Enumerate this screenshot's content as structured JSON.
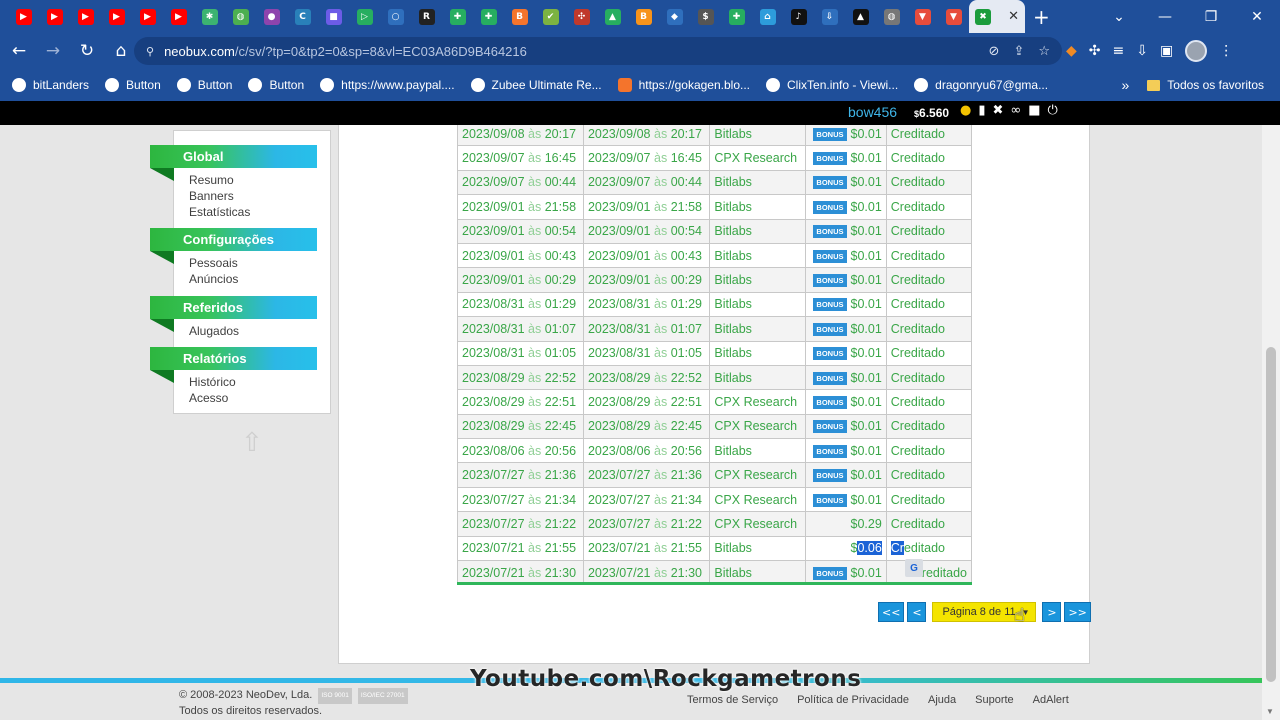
{
  "browser": {
    "tabs": [
      {
        "icon": "youtube-icon",
        "glyph": "▶",
        "color": "#ff0000"
      },
      {
        "icon": "youtube-icon",
        "glyph": "▶",
        "color": "#ff0000"
      },
      {
        "icon": "youtube-icon",
        "glyph": "▶",
        "color": "#ff0000"
      },
      {
        "icon": "youtube-icon",
        "glyph": "▶",
        "color": "#ff0000"
      },
      {
        "icon": "youtube-icon",
        "glyph": "▶",
        "color": "#ff0000"
      },
      {
        "icon": "youtube-icon",
        "glyph": "▶",
        "color": "#ff0000"
      },
      {
        "icon": "pinwheel-icon",
        "glyph": "✱",
        "color": "#3cb371"
      },
      {
        "icon": "globe-icon",
        "glyph": "◍",
        "color": "#4caf50"
      },
      {
        "icon": "pin-icon",
        "glyph": "●",
        "color": "#8e44ad"
      },
      {
        "icon": "circle-c-icon",
        "glyph": "C",
        "color": "#2980b9"
      },
      {
        "icon": "video-icon",
        "glyph": "■",
        "color": "#6c5ce7"
      },
      {
        "icon": "play-icon",
        "glyph": "▷",
        "color": "#27ae60"
      },
      {
        "icon": "circle-icon",
        "glyph": "○",
        "color": "#2f6fbd"
      },
      {
        "icon": "r-icon",
        "glyph": "R",
        "color": "#222222"
      },
      {
        "icon": "leaf-icon",
        "glyph": "✚",
        "color": "#27ae60"
      },
      {
        "icon": "leaf-icon",
        "glyph": "✚",
        "color": "#27ae60"
      },
      {
        "icon": "blogger-icon",
        "glyph": "B",
        "color": "#f4742c"
      },
      {
        "icon": "check-icon",
        "glyph": "✔",
        "color": "#7cb342"
      },
      {
        "icon": "puzzle-icon",
        "glyph": "✣",
        "color": "#c0392b"
      },
      {
        "icon": "triangle-icon",
        "glyph": "▲",
        "color": "#27ae60"
      },
      {
        "icon": "bitcoin-icon",
        "glyph": "B",
        "color": "#f7931a"
      },
      {
        "icon": "ethereum-icon",
        "glyph": "◆",
        "color": "#2f6fbd"
      },
      {
        "icon": "dollar-icon",
        "glyph": "$",
        "color": "#555555"
      },
      {
        "icon": "leaf-icon",
        "glyph": "✚",
        "color": "#27ae60"
      },
      {
        "icon": "home-icon",
        "glyph": "⌂",
        "color": "#2d9cdb"
      },
      {
        "icon": "tiktok-icon",
        "glyph": "♪",
        "color": "#111111"
      },
      {
        "icon": "download-icon",
        "glyph": "⇩",
        "color": "#2f6fbd"
      },
      {
        "icon": "chart-icon",
        "glyph": "▲",
        "color": "#111111"
      },
      {
        "icon": "globe-icon",
        "glyph": "◍",
        "color": "#777777"
      },
      {
        "icon": "shield-icon",
        "glyph": "▼",
        "color": "#e74c3c"
      },
      {
        "icon": "shield-icon",
        "glyph": "▼",
        "color": "#e74c3c"
      }
    ],
    "active_tab_icon": "neobux-icon",
    "url_host": "neobux.com",
    "url_path": "/c/sv/?tp=0&tp2=0&sp=8&vl=EC03A86D9B464216",
    "bookmarks": [
      {
        "label": "bitLanders",
        "icon": "globe-icon"
      },
      {
        "label": "Button",
        "icon": "globe-icon"
      },
      {
        "label": "Button",
        "icon": "globe-icon"
      },
      {
        "label": "Button",
        "icon": "globe-icon"
      },
      {
        "label": "https://www.paypal....",
        "icon": "paypal-icon"
      },
      {
        "label": "Zubee Ultimate Re...",
        "icon": "globe-icon"
      },
      {
        "label": "https://gokagen.blo...",
        "icon": "blogger-icon"
      },
      {
        "label": "ClixTen.info - Viewi...",
        "icon": "globe-icon"
      },
      {
        "label": "dragonryu67@gma...",
        "icon": "google-icon"
      }
    ],
    "all_bookmarks_label": "Todos os favoritos"
  },
  "user": {
    "name": "bow456",
    "balance_symbol": "$",
    "balance": "6.560"
  },
  "sidebar": {
    "sections": [
      {
        "title": "Global",
        "items": [
          "Resumo",
          "Banners",
          "Estatísticas"
        ]
      },
      {
        "title": "Configurações",
        "items": [
          "Pessoais",
          "Anúncios"
        ]
      },
      {
        "title": "Referidos",
        "items": [
          "Alugados"
        ]
      },
      {
        "title": "Relatórios",
        "items": [
          "Histórico",
          "Acesso"
        ]
      }
    ]
  },
  "history": {
    "as_word": "às",
    "bonus_label": "BONUS",
    "rows": [
      {
        "d1": "2023/09/08",
        "t1": "20:17",
        "d2": "2023/09/08",
        "t2": "20:17",
        "source": "Bitlabs",
        "bonus": true,
        "amount": "$0.01",
        "status": "Creditado"
      },
      {
        "d1": "2023/09/07",
        "t1": "16:45",
        "d2": "2023/09/07",
        "t2": "16:45",
        "source": "CPX Research",
        "bonus": true,
        "amount": "$0.01",
        "status": "Creditado"
      },
      {
        "d1": "2023/09/07",
        "t1": "00:44",
        "d2": "2023/09/07",
        "t2": "00:44",
        "source": "Bitlabs",
        "bonus": true,
        "amount": "$0.01",
        "status": "Creditado"
      },
      {
        "d1": "2023/09/01",
        "t1": "21:58",
        "d2": "2023/09/01",
        "t2": "21:58",
        "source": "Bitlabs",
        "bonus": true,
        "amount": "$0.01",
        "status": "Creditado"
      },
      {
        "d1": "2023/09/01",
        "t1": "00:54",
        "d2": "2023/09/01",
        "t2": "00:54",
        "source": "Bitlabs",
        "bonus": true,
        "amount": "$0.01",
        "status": "Creditado"
      },
      {
        "d1": "2023/09/01",
        "t1": "00:43",
        "d2": "2023/09/01",
        "t2": "00:43",
        "source": "Bitlabs",
        "bonus": true,
        "amount": "$0.01",
        "status": "Creditado"
      },
      {
        "d1": "2023/09/01",
        "t1": "00:29",
        "d2": "2023/09/01",
        "t2": "00:29",
        "source": "Bitlabs",
        "bonus": true,
        "amount": "$0.01",
        "status": "Creditado"
      },
      {
        "d1": "2023/08/31",
        "t1": "01:29",
        "d2": "2023/08/31",
        "t2": "01:29",
        "source": "Bitlabs",
        "bonus": true,
        "amount": "$0.01",
        "status": "Creditado"
      },
      {
        "d1": "2023/08/31",
        "t1": "01:07",
        "d2": "2023/08/31",
        "t2": "01:07",
        "source": "Bitlabs",
        "bonus": true,
        "amount": "$0.01",
        "status": "Creditado"
      },
      {
        "d1": "2023/08/31",
        "t1": "01:05",
        "d2": "2023/08/31",
        "t2": "01:05",
        "source": "Bitlabs",
        "bonus": true,
        "amount": "$0.01",
        "status": "Creditado"
      },
      {
        "d1": "2023/08/29",
        "t1": "22:52",
        "d2": "2023/08/29",
        "t2": "22:52",
        "source": "Bitlabs",
        "bonus": true,
        "amount": "$0.01",
        "status": "Creditado"
      },
      {
        "d1": "2023/08/29",
        "t1": "22:51",
        "d2": "2023/08/29",
        "t2": "22:51",
        "source": "CPX Research",
        "bonus": true,
        "amount": "$0.01",
        "status": "Creditado"
      },
      {
        "d1": "2023/08/29",
        "t1": "22:45",
        "d2": "2023/08/29",
        "t2": "22:45",
        "source": "CPX Research",
        "bonus": true,
        "amount": "$0.01",
        "status": "Creditado"
      },
      {
        "d1": "2023/08/06",
        "t1": "20:56",
        "d2": "2023/08/06",
        "t2": "20:56",
        "source": "Bitlabs",
        "bonus": true,
        "amount": "$0.01",
        "status": "Creditado"
      },
      {
        "d1": "2023/07/27",
        "t1": "21:36",
        "d2": "2023/07/27",
        "t2": "21:36",
        "source": "CPX Research",
        "bonus": true,
        "amount": "$0.01",
        "status": "Creditado"
      },
      {
        "d1": "2023/07/27",
        "t1": "21:34",
        "d2": "2023/07/27",
        "t2": "21:34",
        "source": "CPX Research",
        "bonus": true,
        "amount": "$0.01",
        "status": "Creditado"
      },
      {
        "d1": "2023/07/27",
        "t1": "21:22",
        "d2": "2023/07/27",
        "t2": "21:22",
        "source": "CPX Research",
        "bonus": false,
        "amount": "$0.29",
        "status": "Creditado"
      },
      {
        "d1": "2023/07/21",
        "t1": "21:55",
        "d2": "2023/07/21",
        "t2": "21:55",
        "source": "Bitlabs",
        "bonus": false,
        "amount": "$0.06",
        "status": "Creditado",
        "highlight": true
      },
      {
        "d1": "2023/07/21",
        "t1": "21:30",
        "d2": "2023/07/21",
        "t2": "21:30",
        "source": "Bitlabs",
        "bonus": true,
        "amount": "$0.01",
        "status": "Creditado",
        "obscured": true
      }
    ]
  },
  "pager": {
    "first": "<<",
    "prev": "<",
    "page_label": "Página 8 de 11",
    "next": ">",
    "last": ">>"
  },
  "footer": {
    "copyright": "© 2008-2023 NeoDev, Lda.",
    "iso1": "ISO 9001",
    "iso2": "ISO/IEC 27001",
    "rights": "Todos os direitos reservados.",
    "links": [
      "Termos de Serviço",
      "Política de Privacidade",
      "Ajuda",
      "Suporte",
      "AdAlert"
    ]
  },
  "watermark": "Youtube.com\\Rockgametrons"
}
